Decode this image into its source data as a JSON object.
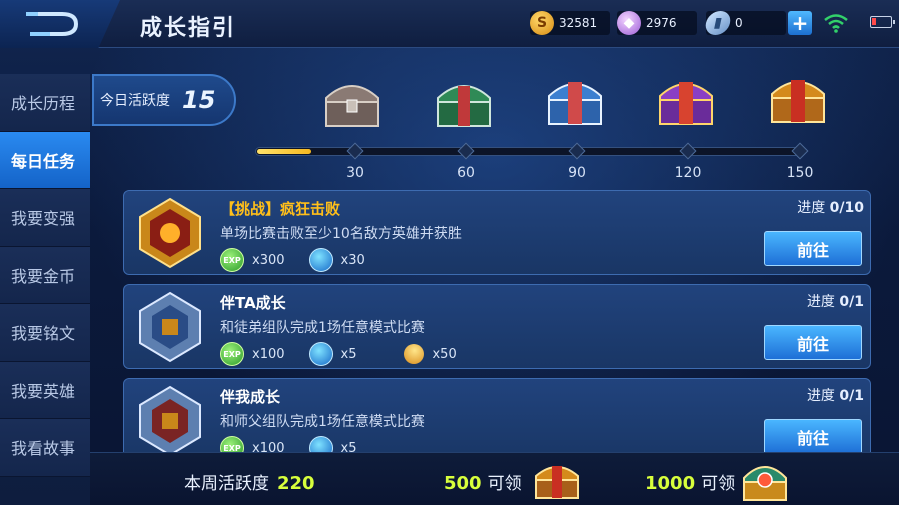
{
  "header": {
    "title": "成长指引",
    "currencies": [
      {
        "name": "gold",
        "value": "32581",
        "symbol": "S"
      },
      {
        "name": "diamond",
        "value": "2976",
        "symbol": "◆"
      },
      {
        "name": "voucher",
        "value": "0",
        "symbol": "▮"
      }
    ],
    "add_symbol": "+"
  },
  "sidebar": {
    "items": [
      {
        "label": "成长历程",
        "active": false
      },
      {
        "label": "每日任务",
        "active": true
      },
      {
        "label": "我要变强",
        "active": false
      },
      {
        "label": "我要金币",
        "active": false
      },
      {
        "label": "我要铭文",
        "active": false
      },
      {
        "label": "我要英雄",
        "active": false
      },
      {
        "label": "我看故事",
        "active": false
      }
    ]
  },
  "activity": {
    "label": "今日活跃度",
    "value": "15",
    "progress_fraction": 0.1,
    "milestones": [
      "30",
      "60",
      "90",
      "120",
      "150"
    ]
  },
  "tasks": [
    {
      "title": "【挑战】疯狂击败",
      "description": "单场比赛击败至少10名敌方英雄并获胜",
      "progress_label": "进度",
      "progress": "0/10",
      "button": "前往",
      "rewards": [
        {
          "icon": "exp-icon",
          "text": "EXP",
          "amount": "x300"
        },
        {
          "icon": "orb-icon",
          "text": "",
          "amount": "x30"
        }
      ]
    },
    {
      "title": "伴TA成长",
      "description": "和徒弟组队完成1场任意模式比赛",
      "progress_label": "进度",
      "progress": "0/1",
      "button": "前往",
      "rewards": [
        {
          "icon": "exp-icon",
          "text": "EXP",
          "amount": "x100"
        },
        {
          "icon": "orb-icon",
          "text": "",
          "amount": "x5"
        },
        {
          "icon": "star-icon",
          "text": "",
          "amount": "x50"
        }
      ]
    },
    {
      "title": "伴我成长",
      "description": "和师父组队完成1场任意模式比赛",
      "progress_label": "进度",
      "progress": "0/1",
      "button": "前往",
      "rewards": [
        {
          "icon": "exp-icon",
          "text": "EXP",
          "amount": "x100"
        },
        {
          "icon": "orb-icon",
          "text": "",
          "amount": "x5"
        }
      ]
    }
  ],
  "footer": {
    "weekly_label": "本周活跃度",
    "weekly_value": "220",
    "claims": [
      {
        "threshold": "500",
        "label": "可领"
      },
      {
        "threshold": "1000",
        "label": "可领"
      }
    ]
  },
  "colors": {
    "accent_blue": "#2a8af0",
    "highlight_yellow": "#d8ff3c",
    "challenge_orange": "#ffbf1a",
    "progress_fill": "#f5b820"
  }
}
